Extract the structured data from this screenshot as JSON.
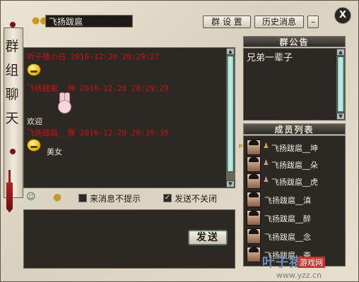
{
  "window": {
    "vertical_title": [
      "群",
      "组",
      "聊",
      "天"
    ],
    "group_name": "飞扬跋扈",
    "buttons": {
      "group_settings": "群 设 置",
      "history": "历史消息",
      "minimize": "–",
      "close": "X"
    }
  },
  "chat": {
    "messages": [
      {
        "header": "听子猪小白 2016-12-20 20:29:27",
        "text": "",
        "sticker": "smiley-emoji"
      },
      {
        "header": "飞扬跋扈__坤 2016-12-20 20:29:29",
        "text": "欢迎",
        "sticker": "bunny-emoji"
      },
      {
        "header": "飞扬跋扈__骞 2016-12-20 20:29:35",
        "text": "美女",
        "sticker": "smiley-emoji"
      }
    ]
  },
  "toolbar": {
    "no_prompt_label": "来消息不提示",
    "no_prompt_checked": false,
    "keep_open_label": "发送不关闭",
    "keep_open_checked": true,
    "send_label": "发送"
  },
  "notice": {
    "title": "群公告",
    "text": "兄弟一辈子"
  },
  "members": {
    "title": "成员列表",
    "list": [
      {
        "name": "飞扬跋扈__坤"
      },
      {
        "name": "飞扬跋扈__朵"
      },
      {
        "name": "飞扬跋扈__虎"
      },
      {
        "name": "飞扬跋扈__滇"
      },
      {
        "name": "飞扬跋扈__醉"
      },
      {
        "name": "飞扬跋扈__念"
      },
      {
        "name": "飞扬跋扈__斋"
      }
    ]
  },
  "watermark": {
    "logo": "叶子猪",
    "badge": "游戏网",
    "url": "www.yzz.cn"
  }
}
